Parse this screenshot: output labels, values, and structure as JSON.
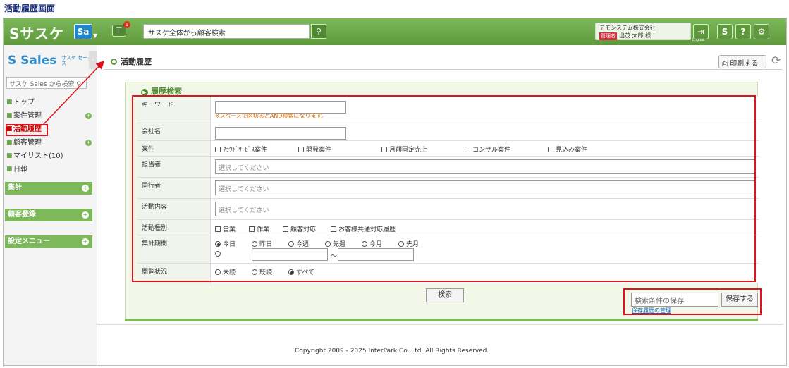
{
  "caption": "活動履歴画面",
  "header": {
    "logo": "Sサスケ",
    "app_switch": "Sa",
    "message_badge": "1",
    "search_placeholder": "サスケ全体から顧客検索",
    "company": "デモシステム株式会社",
    "admin_badge": "管理者",
    "user_name": "出茂 太郎 様",
    "logout_label": "Logout"
  },
  "sidebar": {
    "logo": "Sales",
    "logo_sub": "サスケ セールス",
    "search_placeholder": "サスケ Sales から検索",
    "items": [
      {
        "label": "トップ",
        "has_plus": false
      },
      {
        "label": "案件管理",
        "has_plus": true
      },
      {
        "label": "活動履歴",
        "has_plus": false
      },
      {
        "label": "顧客管理",
        "has_plus": true
      },
      {
        "label": "マイリスト(10)",
        "has_plus": false
      },
      {
        "label": "日報",
        "has_plus": false
      }
    ],
    "sections": [
      "集計",
      "顧客登録",
      "設定メニュー"
    ]
  },
  "main": {
    "breadcrumb": "活動履歴",
    "print_label": "印刷する",
    "panel_title": "履歴検索",
    "form": {
      "keyword_label": "キーワード",
      "keyword_note": "※スペースで区切るとAND検索になります。",
      "company_label": "会社名",
      "project_label": "案件",
      "project_options": [
        "ｸﾗｳﾄﾞｻｰﾋﾞｽ案件",
        "開発案件",
        "月額固定売上",
        "コンサル案件",
        "見込み案件"
      ],
      "staff_label": "担当者",
      "staff_placeholder": "選択してください",
      "companion_label": "同行者",
      "companion_placeholder": "選択してください",
      "content_label": "活動内容",
      "content_placeholder": "選択してください",
      "type_label": "活動種別",
      "type_options": [
        "営業",
        "作業",
        "顧客対応",
        "お客様共通対応履歴"
      ],
      "period_label": "集計期間",
      "period_options": [
        "今日",
        "昨日",
        "今週",
        "先週",
        "今月",
        "先月"
      ],
      "period_selected": "今日",
      "period_sep": "〜",
      "read_label": "閲覧状況",
      "read_options": [
        "未読",
        "既読",
        "すべて"
      ],
      "read_selected": "すべて"
    },
    "search_button": "検索",
    "save_placeholder": "検索条件の保存",
    "save_button": "保存する",
    "save_history_link": "保存履歴の管理"
  },
  "footer": "Copyright 2009 - 2025 InterPark Co.,Ltd. All Rights Reserved.",
  "colors": {
    "brand_green": "#6aa84f",
    "highlight_red": "#e0121b",
    "nav_active": "#cc0000"
  }
}
